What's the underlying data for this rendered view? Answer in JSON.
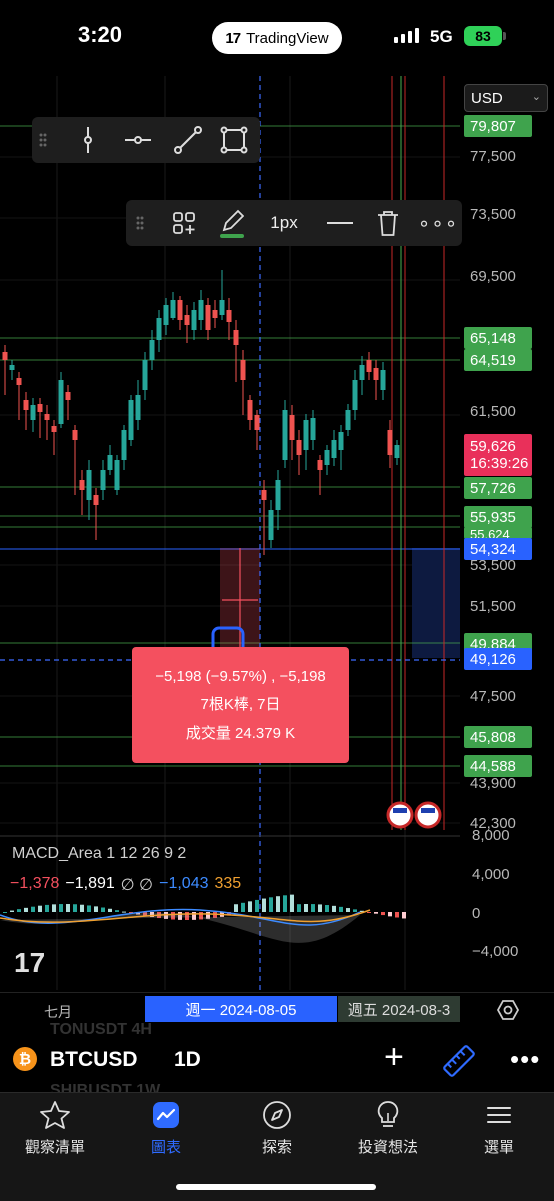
{
  "status": {
    "time": "3:20",
    "network": "5G",
    "battery": "83",
    "app_pill": "TradingView"
  },
  "price_axis": {
    "currency": "USD",
    "ticks": [
      "77,500",
      "73,500",
      "69,500",
      "61,500",
      "53,500",
      "51,500",
      "47,500",
      "43,900",
      "42,300"
    ],
    "labels": {
      "l79807": "79,807",
      "l65148": "65,148",
      "l64519": "64,519",
      "l59626": "59,626",
      "countdown": "16:39:26",
      "l57726": "57,726",
      "l55935": "55,935",
      "l55624": "55,624",
      "l54324": "54,324",
      "l49884": "49,884",
      "l49126": "49,126",
      "l45808": "45,808",
      "l44588": "44,588"
    }
  },
  "toolbar2": {
    "width_label": "1px"
  },
  "measure": {
    "line1": "−5,198 (−9.57%) , −5,198",
    "line2": "7根K棒, 7日",
    "line3": "成交量 24.379 K"
  },
  "macd": {
    "title": "MACD_Area 1 12 26 9 2",
    "v1": "−1,378",
    "v2": "−1,891",
    "v3": "∅ ∅",
    "v4": "−1,043",
    "v5": "335",
    "ticks": [
      "8,000",
      "4,000",
      "0",
      "−4,000"
    ],
    "colors": {
      "v1": "#f4505f",
      "v2": "#ffffff",
      "v4": "#3d8bff",
      "v5": "#f0a030"
    }
  },
  "time_axis": {
    "month": "七月",
    "selected_date": "週一  2024-08-05",
    "end_date": "週五  2024-08-3"
  },
  "symbolbar": {
    "symbol": "BTCUSD",
    "interval": "1D",
    "ghost_top": "TONUSDT      4H",
    "ghost_bottom": "SHIBUSDT      1W"
  },
  "nav": {
    "items": [
      {
        "label": "觀察清單",
        "icon": "star-icon"
      },
      {
        "label": "圖表",
        "icon": "chart-icon"
      },
      {
        "label": "探索",
        "icon": "compass-icon"
      },
      {
        "label": "投資想法",
        "icon": "lightbulb-icon"
      },
      {
        "label": "選單",
        "icon": "menu-icon"
      }
    ]
  },
  "colors": {
    "up": "#26a69a",
    "down": "#ef5350",
    "accent": "#2962ff",
    "green_label": "#3fa34d"
  }
}
